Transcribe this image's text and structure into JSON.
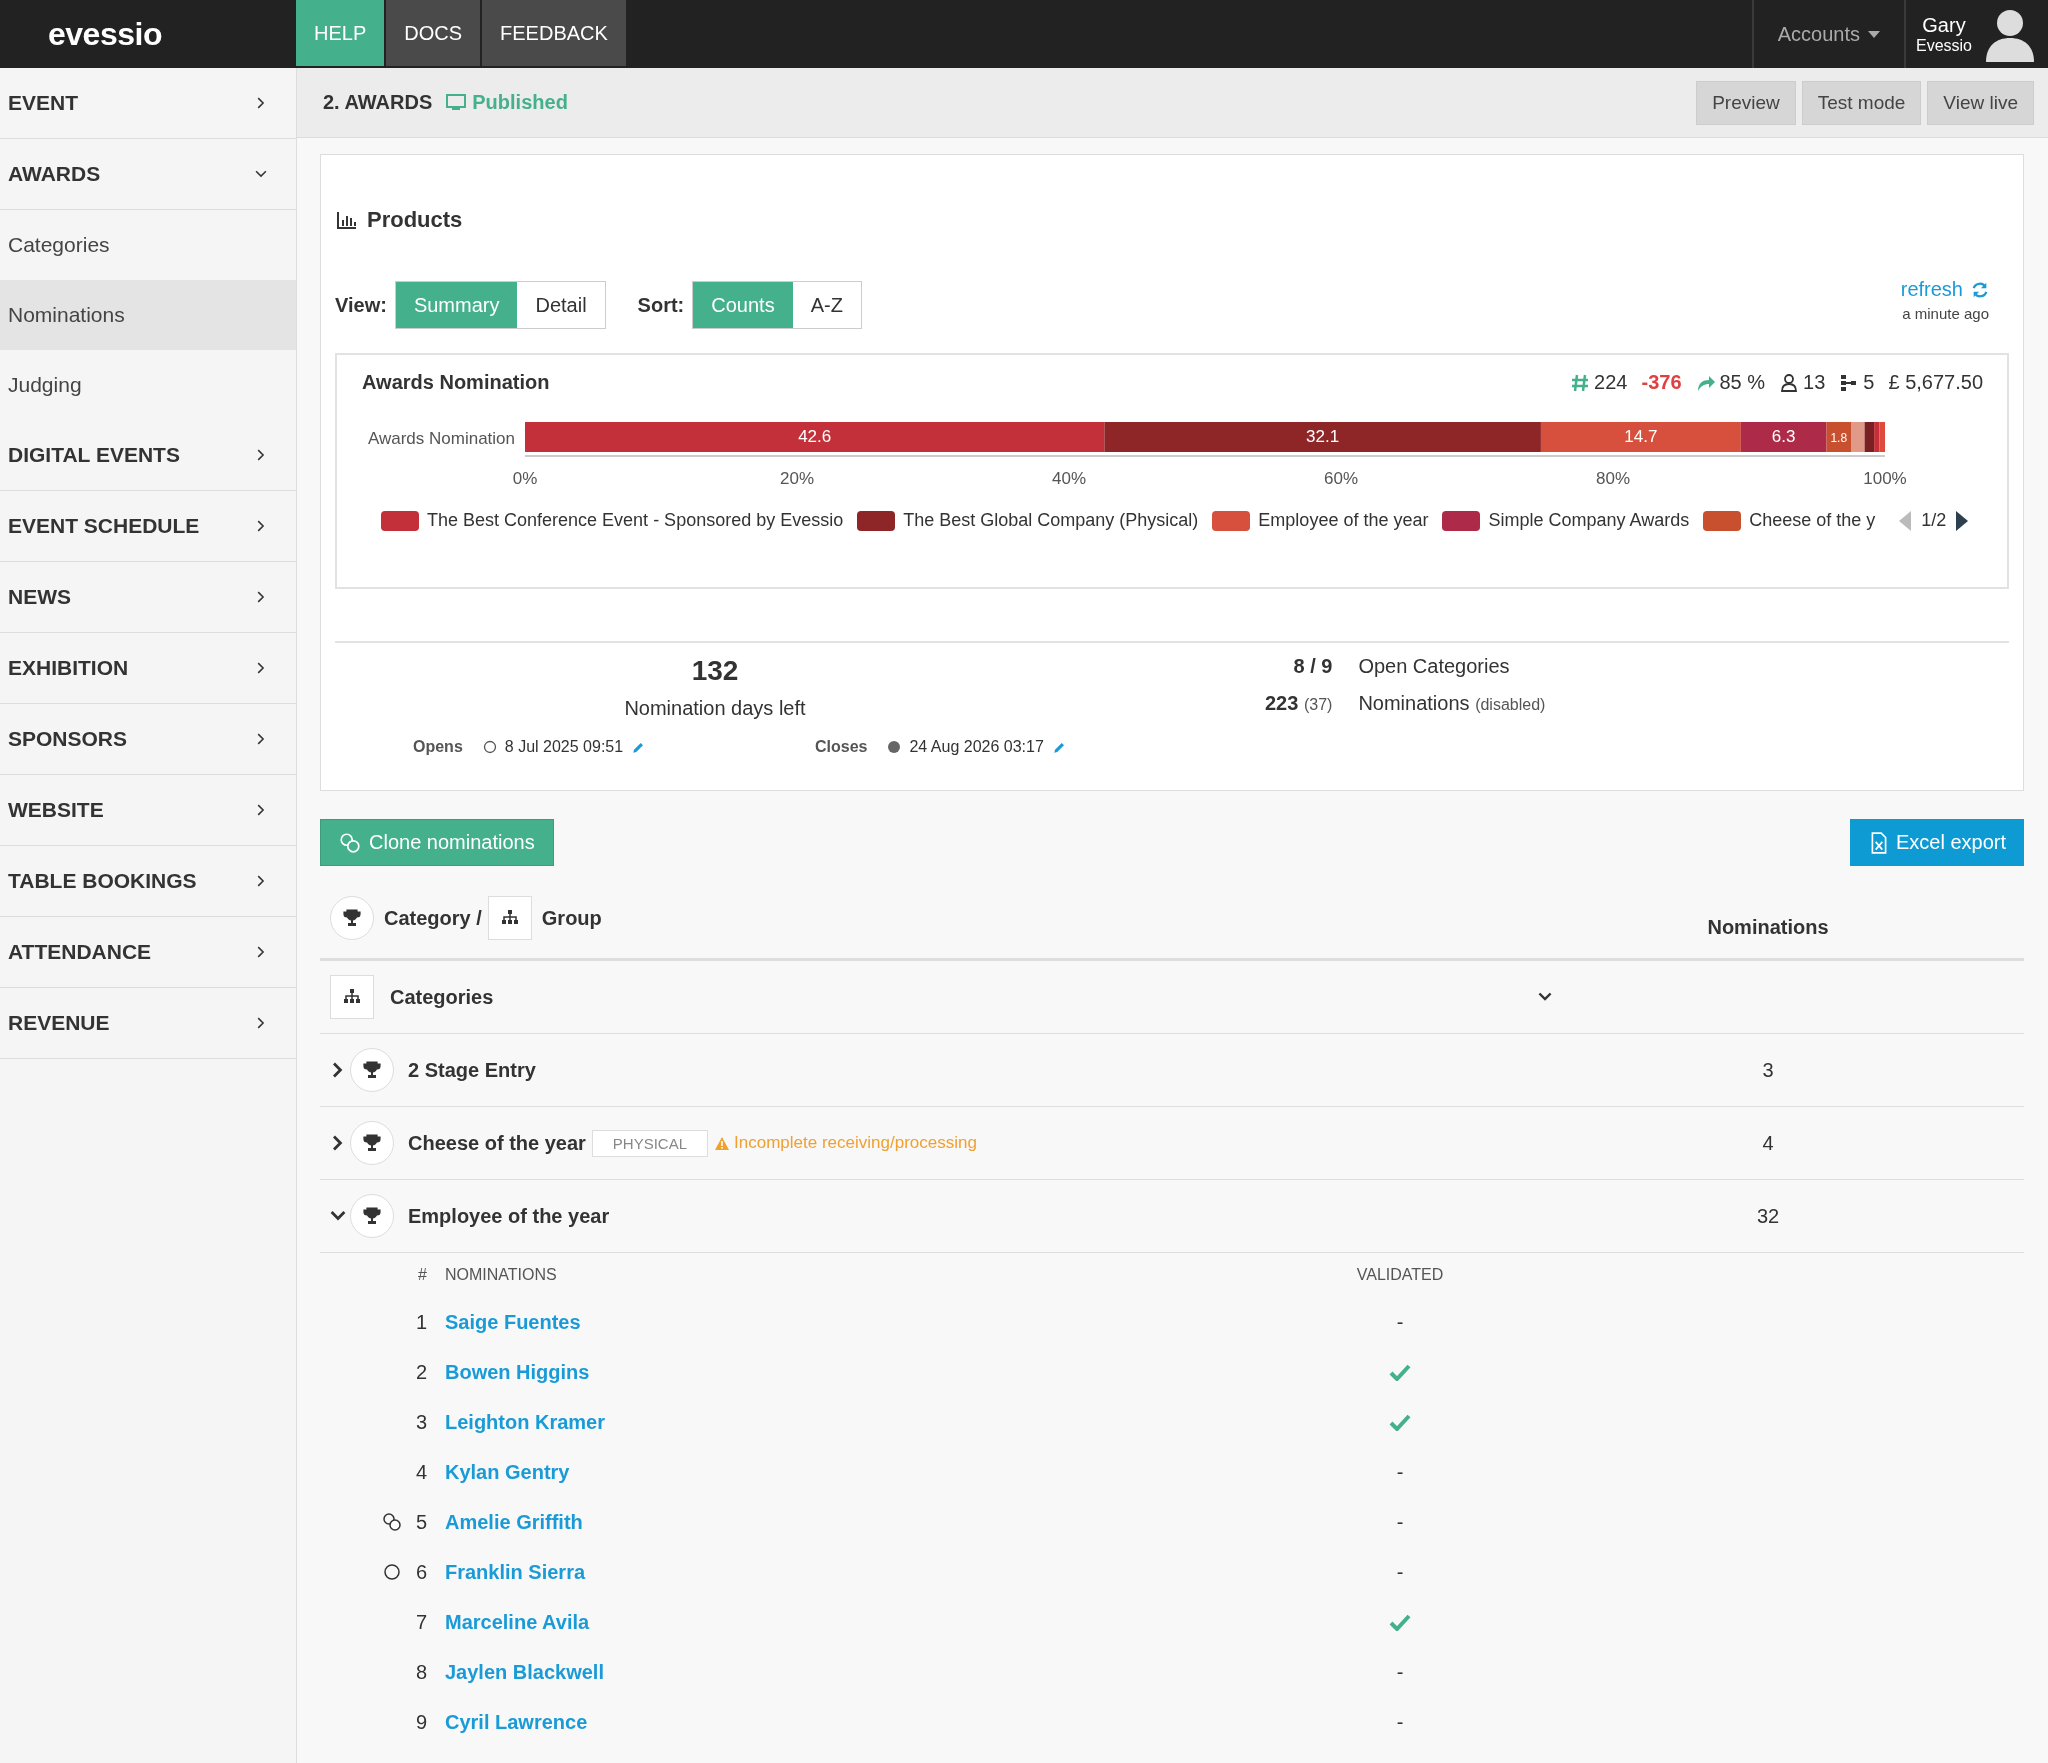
{
  "topbar": {
    "logo": "evessio",
    "tabs": [
      {
        "label": "HELP",
        "selected": true
      },
      {
        "label": "DOCS",
        "selected": false
      },
      {
        "label": "FEEDBACK",
        "selected": false
      }
    ],
    "accounts": "Accounts",
    "user": {
      "name": "Gary",
      "org": "Evessio"
    }
  },
  "sidebar": {
    "items": [
      {
        "label": "EVENT",
        "expanded": false
      },
      {
        "label": "AWARDS",
        "expanded": true,
        "children": [
          {
            "label": "Categories",
            "selected": false
          },
          {
            "label": "Nominations",
            "selected": true
          },
          {
            "label": "Judging",
            "selected": false
          }
        ]
      },
      {
        "label": "DIGITAL EVENTS",
        "expanded": false
      },
      {
        "label": "EVENT SCHEDULE",
        "expanded": false
      },
      {
        "label": "NEWS",
        "expanded": false
      },
      {
        "label": "EXHIBITION",
        "expanded": false
      },
      {
        "label": "SPONSORS",
        "expanded": false
      },
      {
        "label": "WEBSITE",
        "expanded": false
      },
      {
        "label": "TABLE BOOKINGS",
        "expanded": false
      },
      {
        "label": "ATTENDANCE",
        "expanded": false
      },
      {
        "label": "REVENUE",
        "expanded": false
      }
    ]
  },
  "header": {
    "title": "2. AWARDS",
    "status": "Published",
    "buttons": [
      "Preview",
      "Test mode",
      "View live"
    ]
  },
  "panel": {
    "title": "Products",
    "view": {
      "label": "View:",
      "options": [
        {
          "label": "Summary",
          "selected": true
        },
        {
          "label": "Detail",
          "selected": false
        }
      ]
    },
    "sort": {
      "label": "Sort:",
      "options": [
        {
          "label": "Counts",
          "selected": true
        },
        {
          "label": "A-Z",
          "selected": false
        }
      ]
    },
    "refresh": {
      "label": "refresh",
      "time": "a minute ago"
    },
    "chart_card": {
      "title": "Awards Nomination",
      "stats": [
        {
          "kind": "hash",
          "text": "224"
        },
        {
          "kind": "negative",
          "text": "-376"
        },
        {
          "kind": "share",
          "text": "85 %"
        },
        {
          "kind": "user",
          "text": "13"
        },
        {
          "kind": "sitemap",
          "text": "5"
        },
        {
          "kind": "plain",
          "text": "£ 5,677.50"
        }
      ],
      "chart_data": {
        "type": "bar",
        "orientation": "horizontal",
        "stacked": true,
        "categories": [
          "Awards Nomination"
        ],
        "xlim": [
          0,
          100
        ],
        "xticks": [
          {
            "value": 0,
            "label": "0%"
          },
          {
            "value": 20,
            "label": "20%"
          },
          {
            "value": 40,
            "label": "40%"
          },
          {
            "value": 60,
            "label": "60%"
          },
          {
            "value": 80,
            "label": "80%"
          },
          {
            "value": 100,
            "label": "100%"
          }
        ],
        "value_labels": [
          "42.6",
          "32.1",
          "14.7",
          "6.3",
          "1.8",
          null,
          null,
          null,
          null
        ],
        "legend": true,
        "series": [
          {
            "name": "The Best Conference Event - Sponsored by Evessio",
            "color": "#c4303a",
            "values": [
              42.6
            ]
          },
          {
            "name": "The Best Global Company (Physical)",
            "color": "#8e2527",
            "values": [
              32.1
            ]
          },
          {
            "name": "Employee of the year",
            "color": "#d6503d",
            "values": [
              14.7
            ]
          },
          {
            "name": "Simple Company Awards",
            "color": "#ad2a48",
            "values": [
              6.3
            ]
          },
          {
            "name": "Cheese of the y",
            "color": "#c8502f",
            "values": [
              1.8
            ]
          },
          {
            "color": "#e29a88",
            "values": [
              1.0
            ]
          },
          {
            "color": "#7a1f22",
            "values": [
              0.7
            ]
          },
          {
            "color": "#c4303a",
            "values": [
              0.4
            ]
          },
          {
            "color": "#e04a3a",
            "values": [
              0.4
            ]
          }
        ]
      },
      "legend_page": "1/2"
    },
    "summary": {
      "days": "132",
      "days_label": "Nomination days left",
      "dates": [
        {
          "label": "Opens",
          "date": "8 Jul 2025 09:51",
          "filled": false
        },
        {
          "label": "Closes",
          "date": "24 Aug 2026 03:17",
          "filled": true
        }
      ],
      "counts": [
        {
          "value": "8 / 9",
          "label": "Open Categories"
        },
        {
          "value": "223",
          "extra": "(37)",
          "label": "Nominations",
          "note": "(disabled)"
        }
      ]
    }
  },
  "actions": {
    "clone": "Clone nominations",
    "export": "Excel export"
  },
  "table": {
    "columns": {
      "category": "Category /",
      "group": "Group",
      "count": "Nominations"
    },
    "group": {
      "label": "Categories",
      "expanded": true
    },
    "rows": [
      {
        "name": "2 Stage Entry",
        "count": "3",
        "expanded": false
      },
      {
        "name": "Cheese of the year",
        "tag": "PHYSICAL",
        "warning": "Incomplete receiving/processing",
        "count": "4",
        "expanded": false
      },
      {
        "name": "Employee of the year",
        "count": "32",
        "expanded": true,
        "nominations": {
          "columns": [
            "#",
            "NOMINATIONS",
            "VALIDATED"
          ],
          "rows": [
            {
              "number": "1",
              "name": "Saige Fuentes",
              "validated": false,
              "validated_text": "-"
            },
            {
              "number": "2",
              "name": "Bowen Higgins",
              "validated": true
            },
            {
              "number": "3",
              "name": "Leighton Kramer",
              "validated": true
            },
            {
              "number": "4",
              "name": "Kylan Gentry",
              "validated": false,
              "validated_text": "-"
            },
            {
              "number": "5",
              "name": "Amelie Griffith",
              "kind": "clone",
              "validated": false,
              "validated_text": "-"
            },
            {
              "number": "6",
              "name": "Franklin Sierra",
              "kind": "circle",
              "validated": false,
              "validated_text": "-"
            },
            {
              "number": "7",
              "name": "Marceline Avila",
              "validated": true
            },
            {
              "number": "8",
              "name": "Jaylen Blackwell",
              "validated": false,
              "validated_text": "-"
            },
            {
              "number": "9",
              "name": "Cyril Lawrence",
              "validated": false,
              "validated_text": "-"
            }
          ]
        }
      }
    ]
  }
}
